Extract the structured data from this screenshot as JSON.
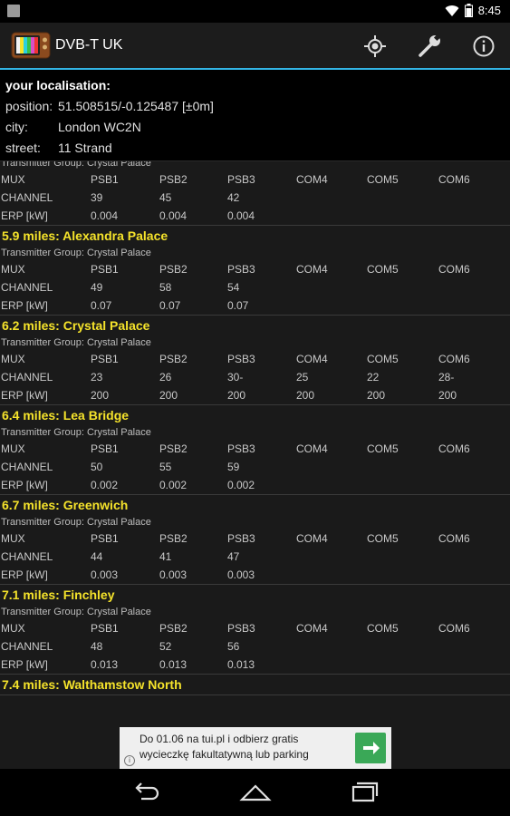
{
  "status_bar": {
    "time": "8:45"
  },
  "app": {
    "title": "DVB-T UK"
  },
  "location": {
    "heading": "your localisation:",
    "position_label": "position:",
    "position_value": "51.508515/-0.125487 [±0m]",
    "city_label": "city:",
    "city_value": "London WC2N",
    "street_label": "street:",
    "street_value": "11 Strand"
  },
  "columns": [
    "MUX",
    "PSB1",
    "PSB2",
    "PSB3",
    "COM4",
    "COM5",
    "COM6"
  ],
  "row_labels": {
    "channel": "CHANNEL",
    "erp": "ERP [kW]"
  },
  "transmitters": [
    {
      "title": "",
      "group": "Transmitter Group: Crystal Palace",
      "channel": [
        "39",
        "45",
        "42",
        "",
        "",
        ""
      ],
      "erp": [
        "0.004",
        "0.004",
        "0.004",
        "",
        "",
        ""
      ]
    },
    {
      "title": "5.9 miles: Alexandra Palace",
      "group": "Transmitter Group: Crystal Palace",
      "channel": [
        "49",
        "58",
        "54",
        "",
        "",
        ""
      ],
      "erp": [
        "0.07",
        "0.07",
        "0.07",
        "",
        "",
        ""
      ]
    },
    {
      "title": "6.2 miles: Crystal Palace",
      "group": "Transmitter Group: Crystal Palace",
      "channel": [
        "23",
        "26",
        "30-",
        "25",
        "22",
        "28-"
      ],
      "erp": [
        "200",
        "200",
        "200",
        "200",
        "200",
        "200"
      ]
    },
    {
      "title": "6.4 miles: Lea Bridge",
      "group": "Transmitter Group: Crystal Palace",
      "channel": [
        "50",
        "55",
        "59",
        "",
        "",
        ""
      ],
      "erp": [
        "0.002",
        "0.002",
        "0.002",
        "",
        "",
        ""
      ]
    },
    {
      "title": "6.7 miles: Greenwich",
      "group": "Transmitter Group: Crystal Palace",
      "channel": [
        "44",
        "41",
        "47",
        "",
        "",
        ""
      ],
      "erp": [
        "0.003",
        "0.003",
        "0.003",
        "",
        "",
        ""
      ]
    },
    {
      "title": "7.1 miles: Finchley",
      "group": "Transmitter Group: Crystal Palace",
      "channel": [
        "48",
        "52",
        "56",
        "",
        "",
        ""
      ],
      "erp": [
        "0.013",
        "0.013",
        "0.013",
        "",
        "",
        ""
      ]
    },
    {
      "title": "7.4 miles: Walthamstow North",
      "group": "",
      "channel": [
        "",
        "",
        "",
        "",
        "",
        ""
      ],
      "erp": [
        "",
        "",
        "",
        "",
        "",
        ""
      ]
    }
  ],
  "ad": {
    "line1": "Do 01.06 na tui.pl i odbierz gratis",
    "line2": "wycieczkę fakultatywną lub parking",
    "info": "i"
  },
  "colors": {
    "accent": "#33b5e5",
    "title_yellow": "#f5e32b",
    "ad_green": "#3aa857"
  }
}
